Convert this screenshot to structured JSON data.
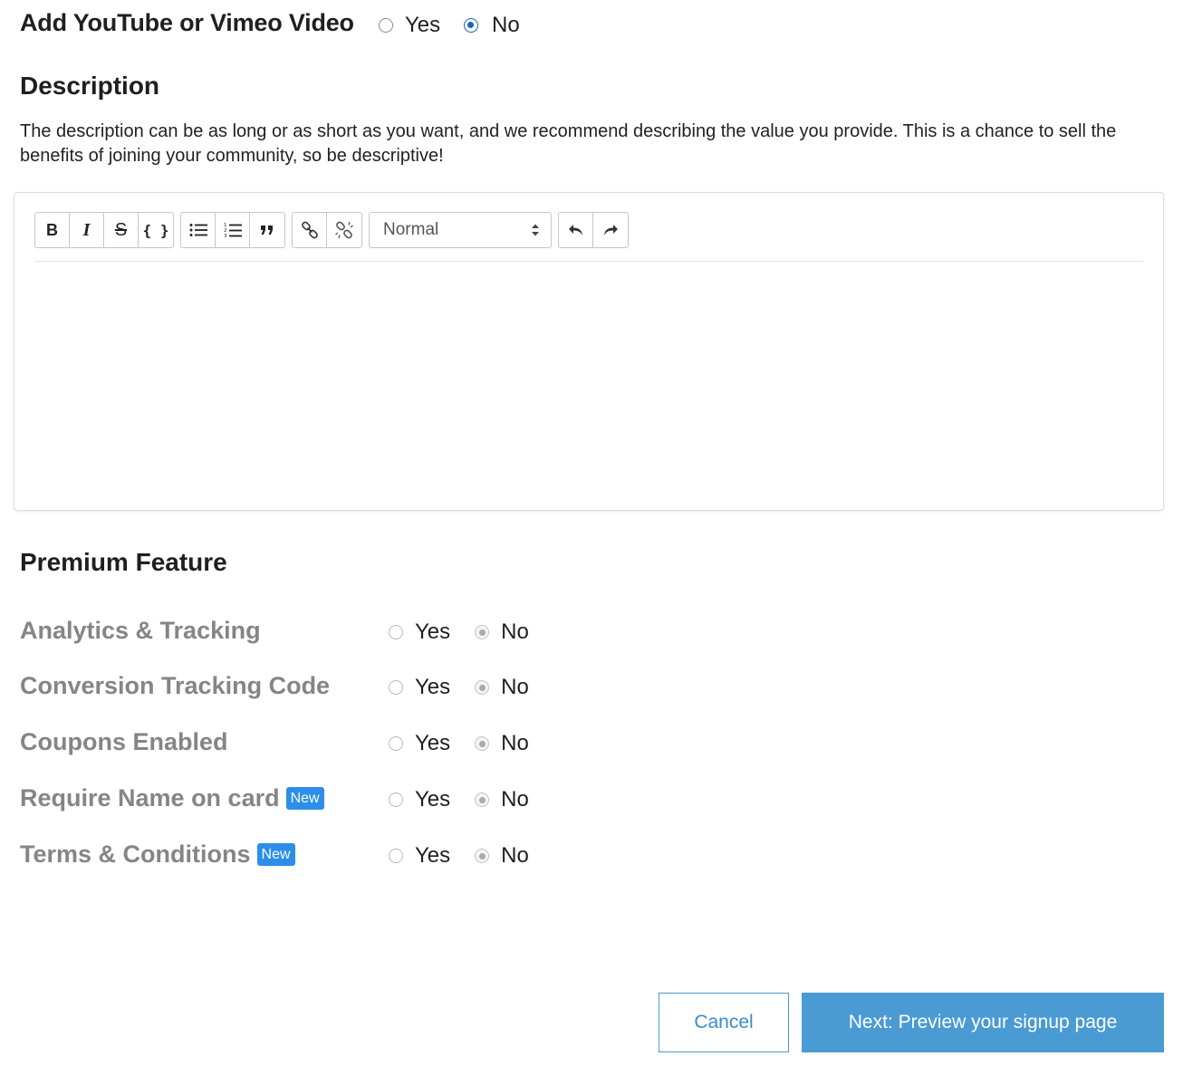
{
  "video": {
    "label": "Add YouTube or Vimeo Video",
    "options": [
      {
        "label": "Yes",
        "selected": false
      },
      {
        "label": "No",
        "selected": true
      }
    ]
  },
  "description": {
    "title": "Description",
    "help_text": "The description can be as long or as short as you want, and we recommend describing the value you provide. This is a chance to sell the benefits of joining your community, so be descriptive!",
    "editor": {
      "toolbar": {
        "bold": "B",
        "italic": "I",
        "strike": "S",
        "code": "{ }",
        "format_select": "Normal",
        "icons": [
          "bold-icon",
          "italic-icon",
          "strikethrough-icon",
          "code-block-icon",
          "bullet-list-icon",
          "ordered-list-icon",
          "blockquote-icon",
          "link-icon",
          "unlink-icon",
          "undo-icon",
          "redo-icon"
        ]
      },
      "content": ""
    }
  },
  "premium": {
    "title": "Premium Feature",
    "new_badge": "New",
    "yes_label": "Yes",
    "no_label": "No",
    "features": [
      {
        "label": "Analytics & Tracking",
        "is_new": false,
        "value": "No"
      },
      {
        "label": "Conversion Tracking Code",
        "is_new": false,
        "value": "No"
      },
      {
        "label": "Coupons Enabled",
        "is_new": false,
        "value": "No"
      },
      {
        "label": "Require Name on card",
        "is_new": true,
        "value": "No"
      },
      {
        "label": "Terms & Conditions",
        "is_new": true,
        "value": "No"
      }
    ]
  },
  "footer": {
    "cancel_label": "Cancel",
    "next_label": "Next: Preview your signup page"
  },
  "colors": {
    "primary_button": "#4a9ad4",
    "radio_selected": "#1565c0",
    "new_badge": "#2d8ee8",
    "feature_label": "#858585"
  }
}
